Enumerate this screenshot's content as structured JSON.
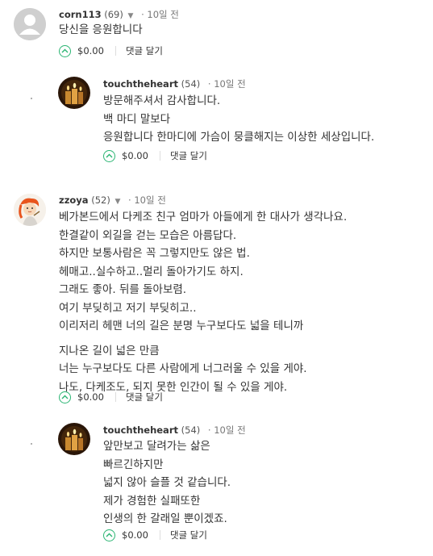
{
  "comments": [
    {
      "author": "corn113",
      "reputation": "(69)",
      "time": "10일 전",
      "avatar": "default-user-icon",
      "paragraphs": [
        [
          "당신을 응원합니다"
        ]
      ],
      "payout": "$0.00",
      "reply_label": "댓글 달기"
    },
    {
      "author": "touchtheheart",
      "reputation": "(54)",
      "time": "10일 전",
      "avatar": "candle-photo",
      "paragraphs": [
        [
          "방문해주셔서 감사합니다.",
          "백 마디 말보다",
          "응원합니다 한마디에 가슴이 뭉클해지는 이상한 세상입니다."
        ]
      ],
      "payout": "$0.00",
      "reply_label": "댓글 달기"
    },
    {
      "author": "zzoya",
      "reputation": "(52)",
      "time": "10일 전",
      "avatar": "illustrated-character",
      "paragraphs": [
        [
          "베가본드에서 다케조 친구 엄마가 아들에게 한 대사가 생각나요.",
          "한결같이 외길을 걷는 모습은 아름답다.",
          "하지만 보통사람은 꼭 그렇지만도 않은 법.",
          "헤매고..실수하고..멀리 돌아가기도 하지.",
          "그래도 좋아. 뒤를 돌아보렴.",
          "여기 부딪히고 저기 부딪히고..",
          "이리저리 헤맨 너의 길은 분명 누구보다도 넓을 테니까"
        ],
        [
          "지나온 길이 넓은 만큼",
          "너는 누구보다도 다른 사람에게 너그러울 수 있을 게야.",
          "나도, 다케조도, 되지 못한 인간이 될 수 있을 게야."
        ]
      ],
      "payout": "$0.00",
      "reply_label": "댓글 달기"
    },
    {
      "author": "touchtheheart",
      "reputation": "(54)",
      "time": "10일 전",
      "avatar": "candle-photo",
      "paragraphs": [
        [
          "앞만보고 달려가는 삶은",
          "빠르긴하지만",
          "넓지 않아 슬플 것 같습니다.",
          "제가 경험한 실패또한",
          "인생의 한 갈래일 뿐이겠죠."
        ]
      ],
      "payout": "$0.00",
      "reply_label": "댓글 달기"
    }
  ],
  "colors": {
    "upvote": "#2bb573",
    "text": "#333333",
    "meta": "#777777"
  }
}
